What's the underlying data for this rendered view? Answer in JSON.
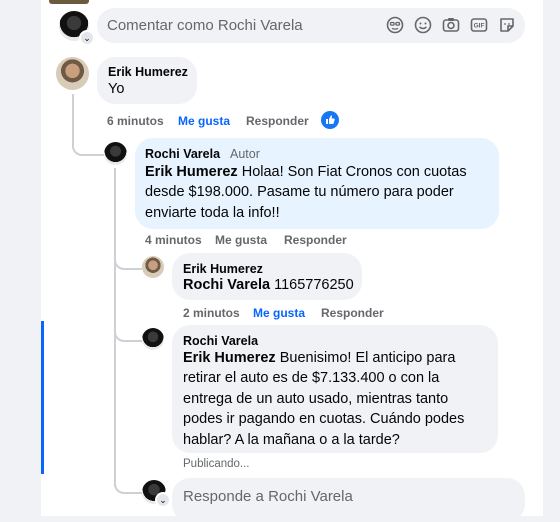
{
  "composer_top": {
    "placeholder": "Comentar como Rochi Varela"
  },
  "comments": [
    {
      "author": "Erik Humerez",
      "text": "Yo",
      "time": "6 minutos",
      "like": "Me gusta",
      "reply": "Responder"
    },
    {
      "author": "Rochi Varela",
      "badge": "Autor",
      "mention": "Erik Humerez",
      "text": " Holaa! Son Fiat Cronos con cuotas desde $198.000. Pasame tu número para poder enviarte toda la info!!",
      "time": "4 minutos",
      "like": "Me gusta",
      "reply": "Responder"
    },
    {
      "author": "Erik Humerez",
      "mention": "Rochi Varela",
      "text": " 1165776250",
      "time": "2 minutos",
      "like": "Me gusta",
      "reply": "Responder"
    },
    {
      "author": "Rochi Varela",
      "mention": "Erik Humerez",
      "text": " Buenisimo! El anticipo para retirar el auto es de $7.133.400 o con la entrega de un auto usado, mientras tanto podes ir pagando en cuotas. Cuándo podes hablar? A la mañana o a la tarde?",
      "status": "Publicando..."
    }
  ],
  "composer_reply": {
    "placeholder": "Responde a Rochi Varela"
  },
  "icons": [
    "sticker-face-icon",
    "emoji-icon",
    "camera-icon",
    "gif-icon",
    "sticker-icon",
    "like-reaction-icon"
  ],
  "colors": {
    "accent": "#0866ff",
    "author_bubble": "#e7f3ff",
    "bubble": "#f0f2f5"
  }
}
